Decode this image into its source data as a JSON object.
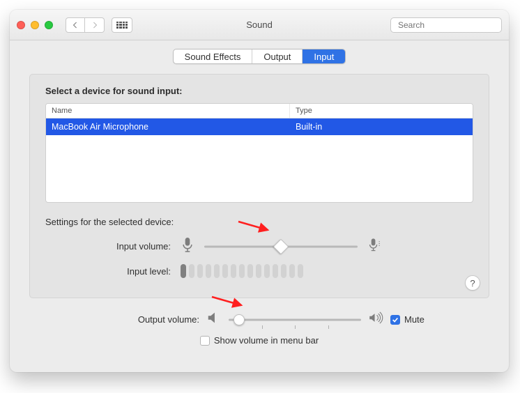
{
  "window": {
    "title": "Sound"
  },
  "toolbar": {
    "search_placeholder": "Search"
  },
  "tabs": {
    "items": [
      "Sound Effects",
      "Output",
      "Input"
    ],
    "active": 2
  },
  "panel": {
    "heading": "Select a device for sound input:",
    "columns": {
      "name": "Name",
      "type": "Type"
    },
    "rows": [
      {
        "name": "MacBook Air Microphone",
        "type": "Built-in",
        "selected": true
      }
    ],
    "settings_label": "Settings for the selected device:",
    "input_volume_label": "Input volume:",
    "input_volume_percent": 50,
    "input_level_label": "Input level:",
    "input_level_active": 1,
    "input_level_total": 15
  },
  "output": {
    "label": "Output volume:",
    "percent": 8,
    "mute_label": "Mute",
    "mute_checked": true,
    "menubar_label": "Show volume in menu bar",
    "menubar_checked": false
  }
}
